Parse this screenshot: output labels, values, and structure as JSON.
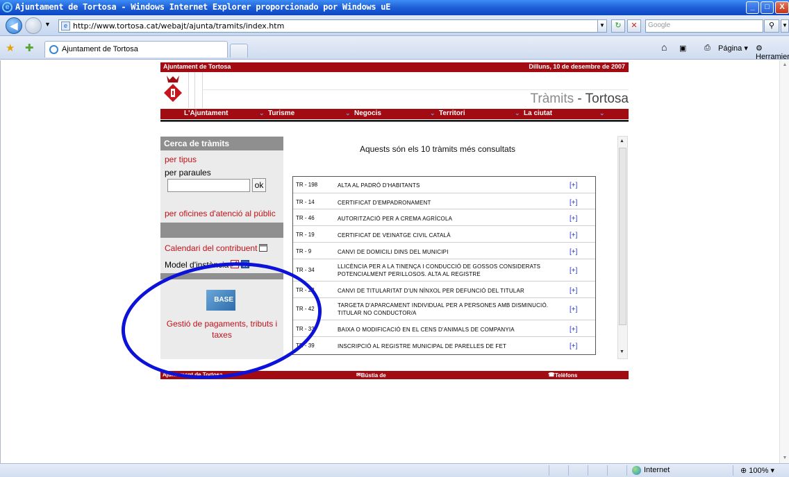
{
  "window": {
    "title": "Ajuntament de Tortosa - Windows Internet Explorer proporcionado por Windows uE",
    "minimize": "_",
    "restore": "□",
    "close": "X"
  },
  "navbar": {
    "url": "http://www.tortosa.cat/webajt/ajunta/tramits/index.htm",
    "search_placeholder": "Google"
  },
  "tabs": {
    "active_tab": "Ajuntament de Tortosa",
    "toolbar_pagina": "Página",
    "toolbar_herramientas": "Herramientas"
  },
  "site": {
    "top_left": "Ajuntament de Tortosa",
    "date": "Dilluns, 10 de desembre de 2007",
    "banner_title_a": "Tràmits",
    "banner_title_b": " - Tortosa",
    "menu": [
      "L'Ajuntament",
      "Turisme",
      "Negocis",
      "Territori",
      "La ciutat"
    ],
    "left": {
      "heading": "Cerca de tràmits",
      "per_tipus": "per tipus",
      "per_paraules": "per paraules",
      "ok": "ok",
      "oficines": "per oficines d'atenció al públic",
      "calendari": "Calendari del contribuent",
      "model": "Model d'instància",
      "base_logo": "BASE",
      "gestio": "Gestió de pagaments, tributs i taxes"
    },
    "intro": "Aquests són els 10 tràmits més consultats",
    "tramits": [
      {
        "code": "TR - 198",
        "desc": "ALTA AL PADRÓ D'HABITANTS",
        "plus": "[+]"
      },
      {
        "code": "TR - 14",
        "desc": "CERTIFICAT D'EMPADRONAMENT",
        "plus": "[+]"
      },
      {
        "code": "TR - 46",
        "desc": "AUTORITZACIÓ PER A CREMA AGRÍCOLA",
        "plus": "[+]"
      },
      {
        "code": "TR - 19",
        "desc": "CERTIFICAT DE VEINATGE CIVIL CATALÀ",
        "plus": "[+]"
      },
      {
        "code": "TR - 9",
        "desc": "CANVI DE DOMICILI DINS DEL MUNICIPI",
        "plus": "[+]"
      },
      {
        "code": "TR - 34",
        "desc": "LLICÈNCIA PER A LA TINENÇA I CONDUCCIÓ DE GOSSOS CONSIDERATS POTENCIALMENT PERILLOSOS. ALTA AL REGISTRE",
        "plus": "[+]"
      },
      {
        "code": "TR - 28",
        "desc": "CANVI DE TITULARITAT D'UN NÍNXOL PER DEFUNCIÓ DEL TITULAR",
        "plus": "[+]"
      },
      {
        "code": "TR - 42",
        "desc": "TARGETA D'APARCAMENT INDIVIDUAL PER A PERSONES AMB DISMINUCIÓ. TITULAR NO CONDUCTOR/A",
        "plus": "[+]"
      },
      {
        "code": "TR - 33",
        "desc": "BAIXA O MODIFICACIÓ EN EL CENS D'ANIMALS DE COMPANYIA",
        "plus": "[+]"
      },
      {
        "code": "TR - 39",
        "desc": "INSCRIPCIÓ AL REGISTRE MUNICIPAL DE PARELLES DE FET",
        "plus": "[+]"
      }
    ],
    "footer_left": "Ajuntament de Tortosa",
    "footer_mid": "Bústia de suggeriments",
    "footer_right": "Telèfons d'interès"
  },
  "statusbar": {
    "zone": "Internet",
    "zoom": "100%"
  },
  "colors": {
    "site_red": "#a30b12",
    "annotation_blue": "#0d12d8",
    "link_red": "#c0111a"
  }
}
